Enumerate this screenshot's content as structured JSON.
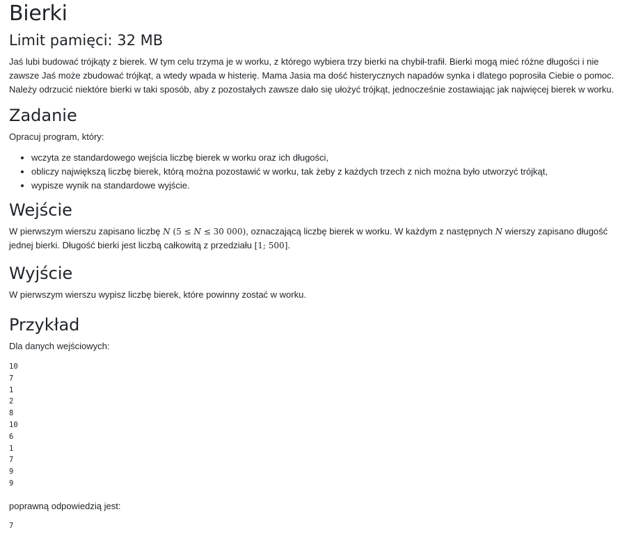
{
  "title": "Bierki",
  "memory_limit": "Limit pamięci: 32 MB",
  "intro": "Jaś lubi budować trójkąty z bierek. W tym celu trzyma je w worku, z którego wybiera trzy bierki na chybił-trafił. Bierki mogą mieć różne długości i nie zawsze Jaś może zbudować trójkąt, a wtedy wpada w histerię. Mama Jasia ma dość histerycznych napadów synka i dlatego poprosiła Ciebie o pomoc. Należy odrzucić niektóre bierki w taki sposób, aby z pozostałych zawsze dało się ułożyć trójkąt, jednocześnie zostawiając jak najwięcej bierek w worku.",
  "task": {
    "heading": "Zadanie",
    "lead": "Opracuj program, który:",
    "items": [
      "wczyta ze standardowego wejścia liczbę bierek w worku oraz ich długości,",
      "obliczy największą liczbę bierek, którą można pozostawić w worku, tak żeby z każdych trzech z nich można było utworzyć trójkąt,",
      "wypisze wynik na standardowe wyjście."
    ]
  },
  "input": {
    "heading": "Wejście",
    "text_1": "W pierwszym wierszu zapisano liczbę ",
    "math_n": "N",
    "math_range_open": " (5 ≤ ",
    "math_range_close": " ≤ 30 000)",
    "text_2": ", oznaczającą liczbę bierek w worku. W każdym z następnych ",
    "text_3": " wierszy zapisano długość jednej bierki. Długość bierki jest liczbą całkowitą z przedziału ",
    "math_interval": "[1; 500]",
    "text_4": "."
  },
  "output": {
    "heading": "Wyjście",
    "text": "W pierwszym wierszu wypisz liczbę bierek, które powinny zostać w worku."
  },
  "example": {
    "heading": "Przykład",
    "input_lead": "Dla danych wejściowych:",
    "input_data": "10\n7\n1\n2\n8\n10\n6\n1\n7\n9\n9",
    "answer_lead": "poprawną odpowiedzią jest:",
    "answer_data": "7"
  }
}
